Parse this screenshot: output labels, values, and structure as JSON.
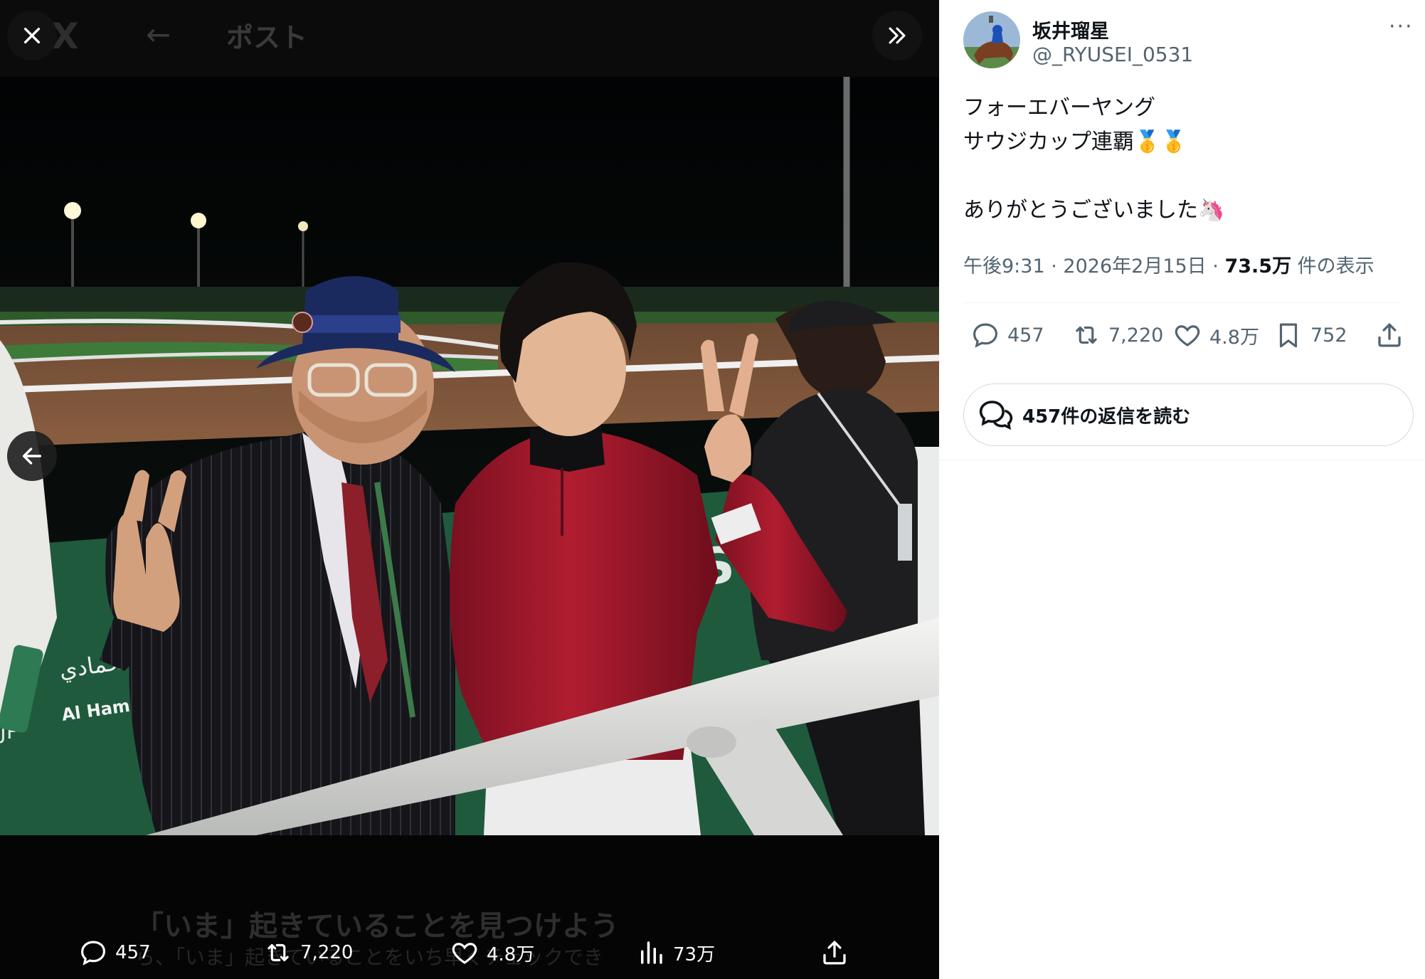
{
  "viewer": {
    "ghost_header": {
      "logo": "X",
      "back_arrow": "←",
      "title": "ポスト"
    },
    "ghost_footer": {
      "headline": "「いま」起きていることを見つけよう",
      "subtext": "ら、「いま」起きていることをいち早くチェックでき"
    },
    "photo": {
      "sign_arabic": "مستشفيات الحمادي",
      "sign_latin": "Al Hammadi Hospitals",
      "sign_partial": "S",
      "sign_edge": "JP"
    },
    "actions": {
      "reply_count": "457",
      "retweet_count": "7,220",
      "like_count": "4.8万",
      "view_count": "73万"
    },
    "icons": {
      "close": "close-icon",
      "collapse": "double-chevron-right-icon",
      "prev": "arrow-left-icon",
      "reply": "reply-icon",
      "retweet": "retweet-icon",
      "like": "heart-icon",
      "views": "views-icon",
      "share": "share-icon"
    }
  },
  "post": {
    "author": {
      "name": "坂井瑠星",
      "handle": "@_RYUSEI_0531"
    },
    "text_lines": [
      "フォーエバーヤング",
      "サウジカップ連覇",
      "",
      "ありがとうございました"
    ],
    "emojis": {
      "medal": "🥇",
      "unicorn": "🦄"
    },
    "meta": {
      "time": "午後9:31",
      "date": "2026年2月15日",
      "views": "73.5万",
      "views_suffix": "件の表示",
      "separator": "·"
    },
    "actions": {
      "reply_count": "457",
      "retweet_count": "7,220",
      "like_count": "4.8万",
      "bookmark_count": "752"
    },
    "read_replies_label": "457件の返信を読む",
    "more": "···"
  },
  "colors": {
    "text_primary": "#0f1419",
    "text_secondary": "#536471",
    "border": "#cfd9de",
    "viewer_bg": "#070707",
    "silks_red": "#a3192b"
  }
}
